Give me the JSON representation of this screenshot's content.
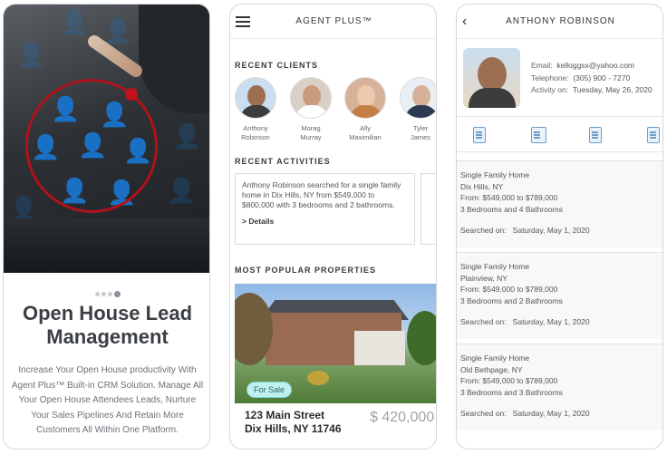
{
  "panel1": {
    "title": "Open House Lead Management",
    "body": "Increase Your Open House productivity With Agent Plus™ Built-in CRM Solution. Manage All Your Open House Attendees Leads, Nurture Your Sales Pipelines And Retain More Customers All Within One Platform.",
    "pager": {
      "count": 4,
      "active_index": 3
    }
  },
  "panel2": {
    "header": {
      "title": "AGENT PLUS™"
    },
    "recent_clients": {
      "title": "RECENT CLIENTS",
      "clients": [
        {
          "name_line1": "Anthony",
          "name_line2": "Robinson"
        },
        {
          "name_line1": "Morag",
          "name_line2": "Murray"
        },
        {
          "name_line1": "Ally",
          "name_line2": "Maximilian"
        },
        {
          "name_line1": "Tyler",
          "name_line2": "James"
        }
      ]
    },
    "recent_activities": {
      "title": "RECENT ACTIVITIES",
      "items": [
        {
          "text": "Anthony Robinson searched for a single family home in Dix Hills, NY from $549,000 to $800,000  with 3 bedrooms and 2 bathrooms.",
          "link": "> Details"
        }
      ]
    },
    "popular": {
      "title": "MOST POPULAR PROPERTIES",
      "badge": "For Sale",
      "address_line1": "123 Main Street",
      "address_line2": "Dix Hills, NY 11746",
      "price": "$ 420,000"
    }
  },
  "panel3": {
    "header": {
      "title": "ANTHONY ROBINSON"
    },
    "contact": {
      "email_label": "Email:",
      "email": "kelloggsx@yahoo.com",
      "phone_label": "Telephone:",
      "phone": "(305) 900 - 7270",
      "activity_label": "Activity on:",
      "activity": "Tuesday, May 26, 2020"
    },
    "searches": [
      {
        "type": "Single Family Home",
        "location": "Dix Hills, NY",
        "range": "From:  $549,000 to $789,000",
        "rooms": "3 Bedrooms and 4 Bathrooms",
        "searched_label": "Searched on:",
        "searched_date": "Saturday,  May 1, 2020"
      },
      {
        "type": "Single Family Home",
        "location": "Plainview, NY",
        "range": "From:  $549,000 to $789,000",
        "rooms": "3 Bedrooms and 2 Bathrooms",
        "searched_label": "Searched on:",
        "searched_date": "Saturday,  May 1, 2020"
      },
      {
        "type": "Single Family Home",
        "location": "Old Bethpage, NY",
        "range": "From:  $549,000 to $789,000",
        "rooms": "3 Bedrooms and 3 Bathrooms",
        "searched_label": "Searched on:",
        "searched_date": "Saturday,  May 1, 2020"
      }
    ]
  },
  "colors": {
    "accent_teal": "#bff0ee",
    "icon_blue": "#6f9ec9",
    "ring_red": "#b0121a"
  }
}
